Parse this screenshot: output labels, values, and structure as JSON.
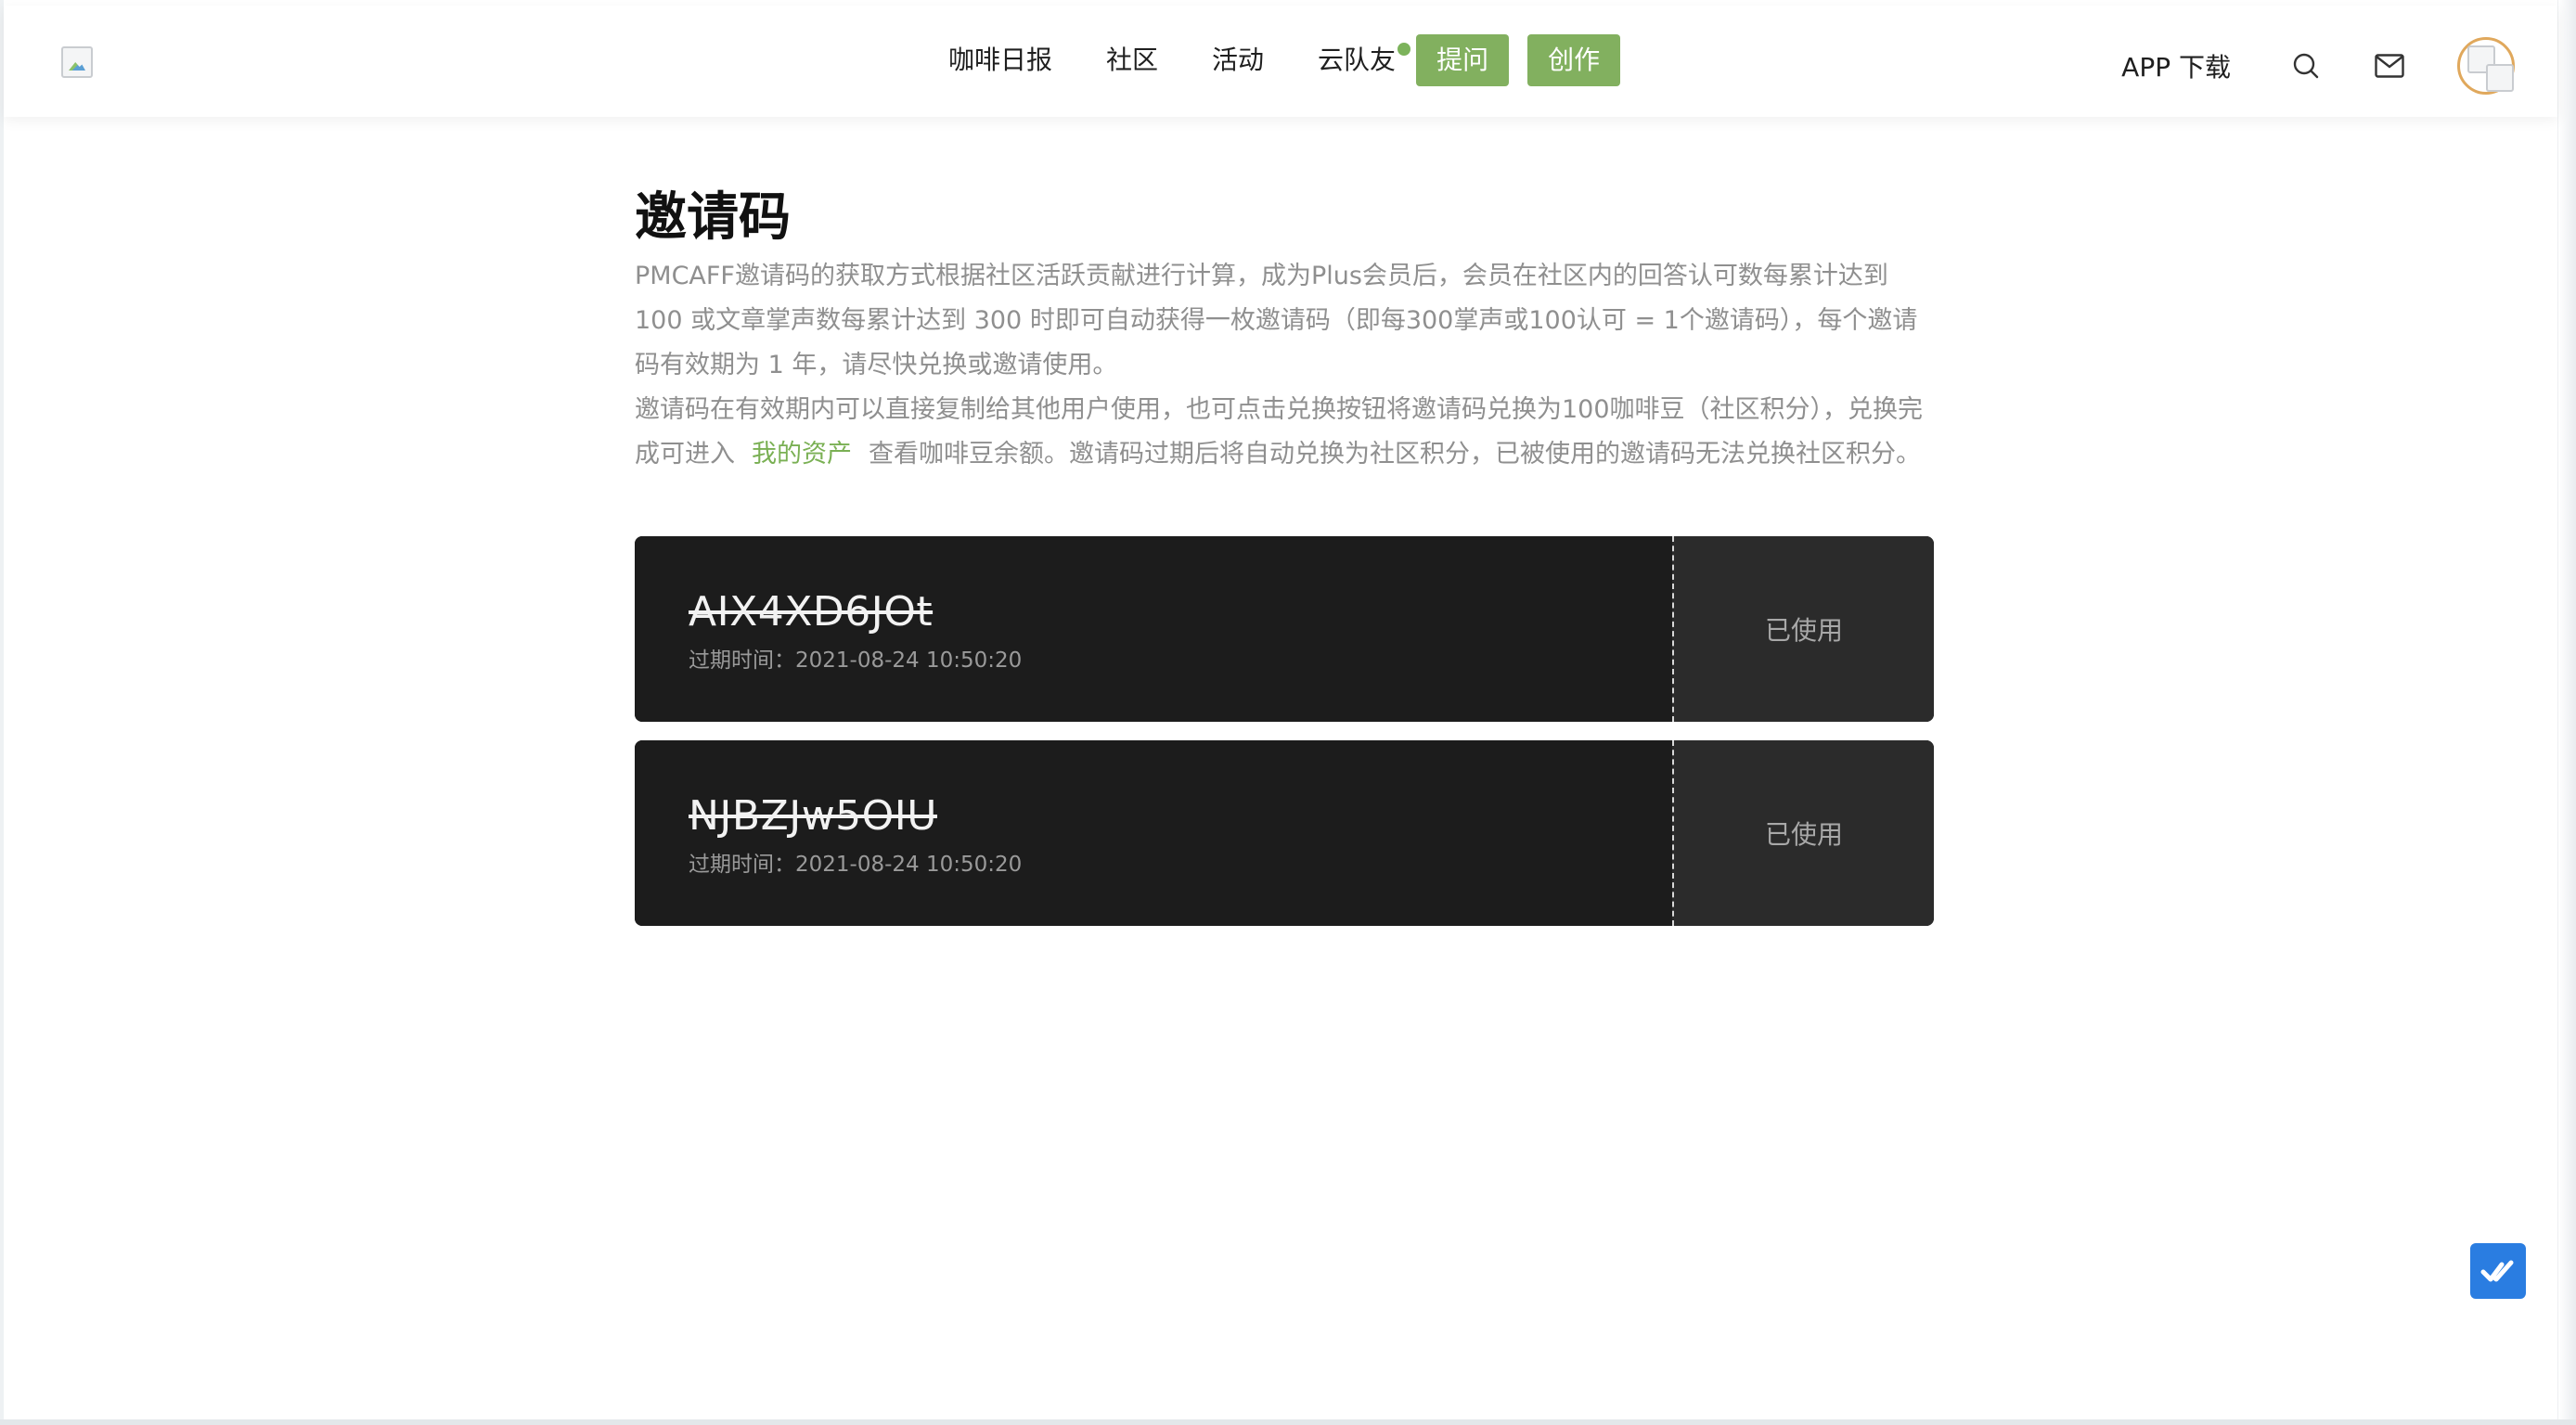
{
  "header": {
    "logo_alt": "",
    "nav": [
      {
        "label": "咖啡日报"
      },
      {
        "label": "社区"
      },
      {
        "label": "活动"
      },
      {
        "label": "云队友"
      }
    ],
    "ask_button": "提问",
    "create_button": "创作",
    "app_download": "APP 下载",
    "icons": [
      "search-icon",
      "mail-icon",
      "avatar"
    ]
  },
  "main": {
    "title": "邀请码",
    "desc_p1": "PMCAFF邀请码的获取方式根据社区活跃贡献进行计算，成为Plus会员后，会员在社区内的回答认可数每累计达到100 或文章掌声数每累计达到 300 时即可自动获得一枚邀请码（即每300掌声或100认可 = 1个邀请码），每个邀请码有效期为 1 年，请尽快兑换或邀请使用。",
    "desc_p2_before": "邀请码在有效期内可以直接复制给其他用户使用，也可点击兑换按钮将邀请码兑换为100咖啡豆（社区积分），兑换完成可进入",
    "desc_p2_link": "我的资产",
    "desc_p2_after": "查看咖啡豆余额。邀请码过期后将自动兑换为社区积分，已被使用的邀请码无法兑换社区积分。"
  },
  "codes": [
    {
      "code": "AIX4XD6JOt",
      "expire": "过期时间：2021-08-24 10:50:20",
      "status": "已使用"
    },
    {
      "code": "NJBZJw5OIU",
      "expire": "过期时间：2021-08-24 10:50:20",
      "status": "已使用"
    }
  ],
  "colors": {
    "accent_green": "#82b05f",
    "link_green": "#7ab054",
    "card_bg": "#1c1c1c",
    "float_button": "#2a7de1"
  }
}
